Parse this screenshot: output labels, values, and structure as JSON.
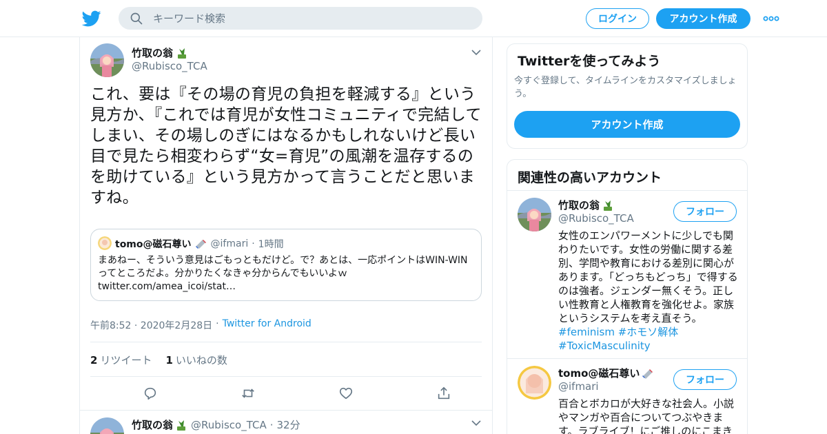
{
  "header": {
    "search_placeholder": "キーワード検索",
    "login_label": "ログイン",
    "signup_label": "アカウント作成",
    "brand_color": "#1da1f2"
  },
  "tweet": {
    "author_name": "竹取の翁",
    "author_handle": "@Rubisco_TCA",
    "text": "これ、要は『その場の育児の負担を軽減する』という見方か、『これでは育児が女性コミュニティで完結してしまい、その場しのぎにはなるかもしれないけど長い目で見たら相変わらず“女=育児”の風潮を温存するのを助けている』という見方かって言うことだと思いますね。",
    "quote": {
      "author_name": "tomo@磁石尊い",
      "author_handle": "@ifmari",
      "separator": "·",
      "time": "1時間",
      "text": "まあねー、そういう意見はごもっともだけど。で？あとは、一応ポイントはWIN-WINってところだよ。分かりたくなきゃ分からんでもいいよｗ twitter.com/amea_icoi/stat…"
    },
    "timestamp": "午前8:52 · 2020年2月28日",
    "separator": "·",
    "source": "Twitter for Android",
    "retweets_count": "2",
    "retweets_label": "リツイート",
    "likes_count": "1",
    "likes_label": "いいねの数"
  },
  "reply": {
    "author_name": "竹取の翁",
    "author_handle": "@Rubisco_TCA",
    "separator": "·",
    "time": "32分"
  },
  "sidebar": {
    "signup_card": {
      "title": "Twitterを使ってみよう",
      "description": "今すぐ登録して、タイムラインをカスタマイズしましょう。",
      "button_label": "アカウント作成"
    },
    "related": {
      "title": "関連性の高いアカウント",
      "accounts": [
        {
          "name": "竹取の翁",
          "handle": "@Rubisco_TCA",
          "follow_label": "フォロー",
          "bio": "女性のエンパワーメントに少しでも関わりたいです。女性の労働に関する差別、学問や教育における差別に関心があります。「どっちもどっち」で得するのは強者。ジェンダー無くそう。正しい性教育と人権教育を強化せよ。家族というシステムを考え直そう。",
          "tags": "#feminism #ホモソ解体 #ToxicMasculinity"
        },
        {
          "name": "tomo@磁石尊い",
          "handle": "@ifmari",
          "follow_label": "フォロー",
          "bio": "百合とボカロが大好きな社会人。小説やマンガや百合についてつぶやきます。ラブライブ！にご推しのにこまき"
        }
      ]
    }
  }
}
